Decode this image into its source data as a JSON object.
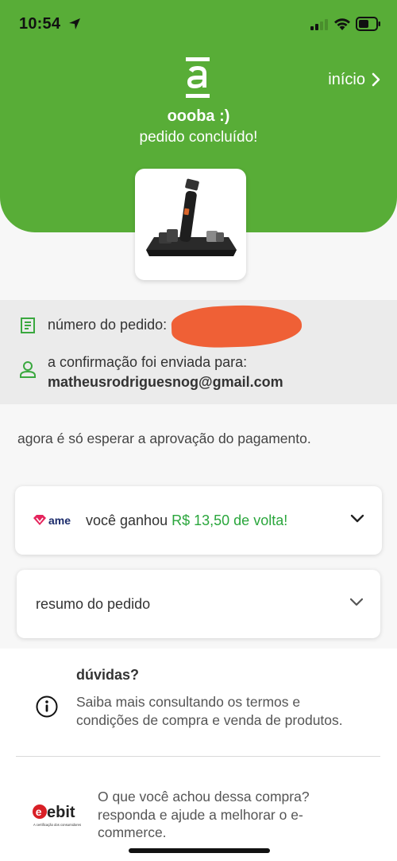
{
  "status_bar": {
    "time": "10:54"
  },
  "header": {
    "home_label": "início",
    "greeting": "oooba :)",
    "status": "pedido concluído!"
  },
  "order": {
    "number_label": "número do pedido:",
    "confirmation_label": "a confirmação foi enviada para:",
    "email": "matheusrodriguesnog@gmail.com"
  },
  "wait_message": "agora é só esperar a aprovação do pagamento.",
  "cashback": {
    "brand": "ame",
    "text": "você ganhou",
    "value": "R$ 13,50 de volta!"
  },
  "summary": {
    "label": "resumo do pedido"
  },
  "faq": {
    "title": "dúvidas?",
    "text": "Saiba mais consultando os termos e condições de compra e venda de produtos."
  },
  "ebit": {
    "logo_text": "ebit",
    "logo_tagline": "A certificação dos consumidores",
    "text": "O que você achou dessa compra? responda e ajude a melhorar o e-commerce."
  },
  "colors": {
    "brand_green": "#58ad37",
    "cashback_green": "#2aa63c",
    "ame_pink": "#e5255d",
    "ebit_red": "#d81f26",
    "icon_green": "#3aa83f"
  }
}
